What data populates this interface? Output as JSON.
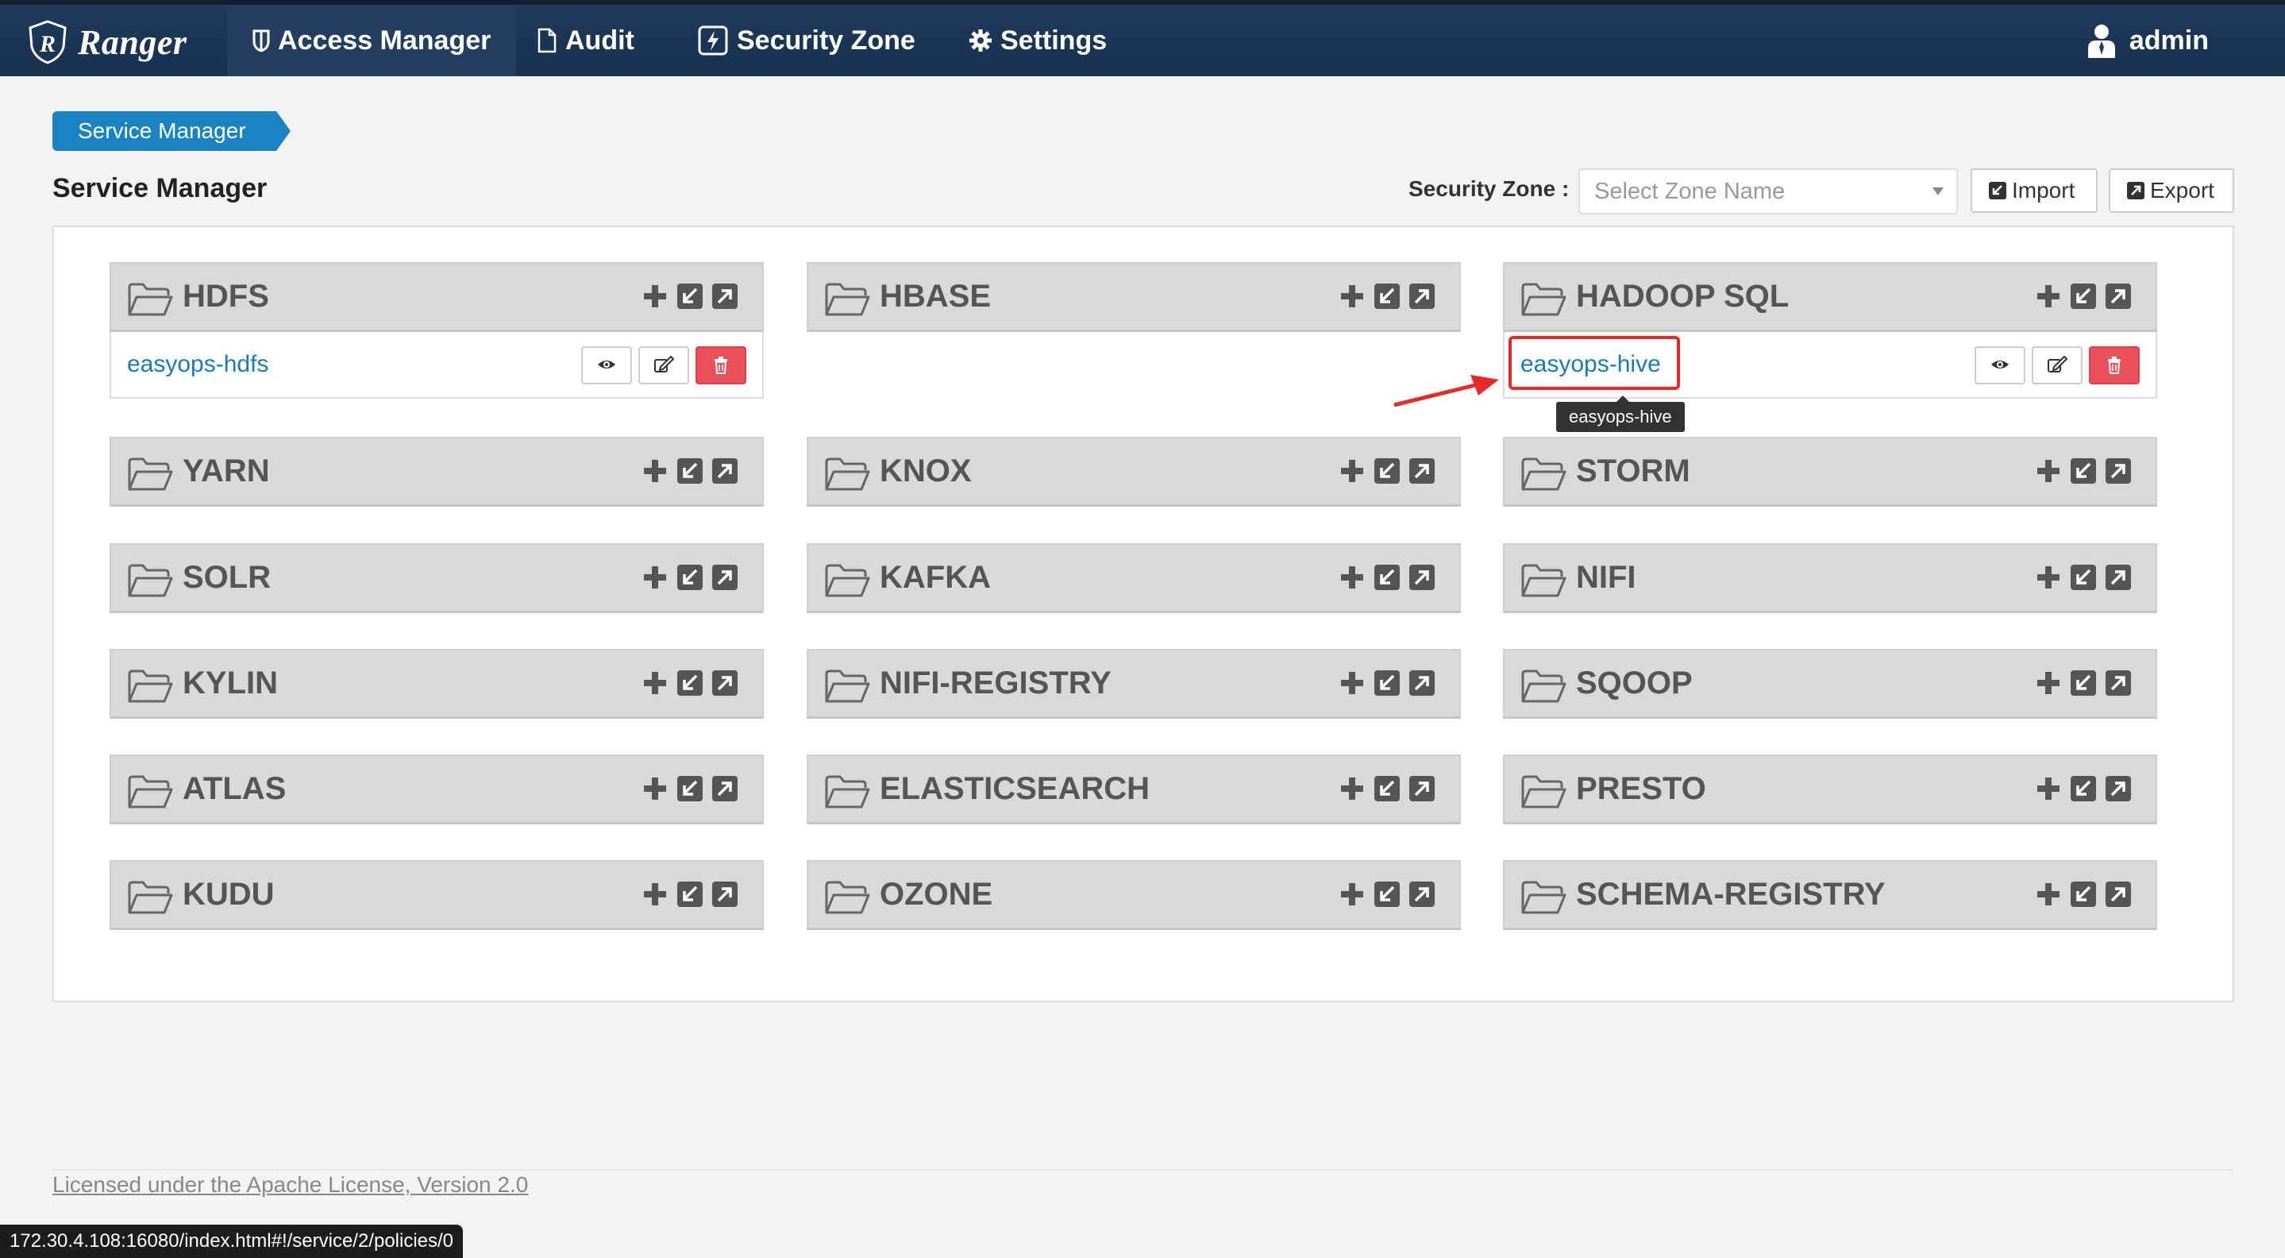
{
  "nav": {
    "brand": "Ranger",
    "items": [
      {
        "label": "Access Manager",
        "icon": "shield-icon"
      },
      {
        "label": "Audit",
        "icon": "file-icon"
      },
      {
        "label": "Security Zone",
        "icon": "bolt-icon"
      },
      {
        "label": "Settings",
        "icon": "gear-icon"
      }
    ],
    "user": "admin"
  },
  "breadcrumb": "Service Manager",
  "page_title": "Service Manager",
  "security_zone": {
    "label": "Security Zone :",
    "placeholder": "Select Zone Name"
  },
  "buttons": {
    "import": "Import",
    "export": "Export"
  },
  "services": [
    {
      "name": "HDFS",
      "instances": [
        "easyops-hdfs"
      ]
    },
    {
      "name": "HBASE",
      "instances": []
    },
    {
      "name": "HADOOP SQL",
      "instances": [
        "easyops-hive"
      ]
    },
    {
      "name": "YARN",
      "instances": []
    },
    {
      "name": "KNOX",
      "instances": []
    },
    {
      "name": "STORM",
      "instances": []
    },
    {
      "name": "SOLR",
      "instances": []
    },
    {
      "name": "KAFKA",
      "instances": []
    },
    {
      "name": "NIFI",
      "instances": []
    },
    {
      "name": "KYLIN",
      "instances": []
    },
    {
      "name": "NIFI-REGISTRY",
      "instances": []
    },
    {
      "name": "SQOOP",
      "instances": []
    },
    {
      "name": "ATLAS",
      "instances": []
    },
    {
      "name": "ELASTICSEARCH",
      "instances": []
    },
    {
      "name": "PRESTO",
      "instances": []
    },
    {
      "name": "KUDU",
      "instances": []
    },
    {
      "name": "OZONE",
      "instances": []
    },
    {
      "name": "SCHEMA-REGISTRY",
      "instances": []
    }
  ],
  "tooltip": "easyops-hive",
  "footer": {
    "license": "Licensed under the Apache License, Version 2.0"
  },
  "status_url": "172.30.4.108:16080/index.html#!/service/2/policies/0",
  "colors": {
    "nav_bg": "#1f3a5b",
    "accent": "#1b83c1",
    "delete": "#e8505b",
    "highlight": "#e62a2a"
  }
}
